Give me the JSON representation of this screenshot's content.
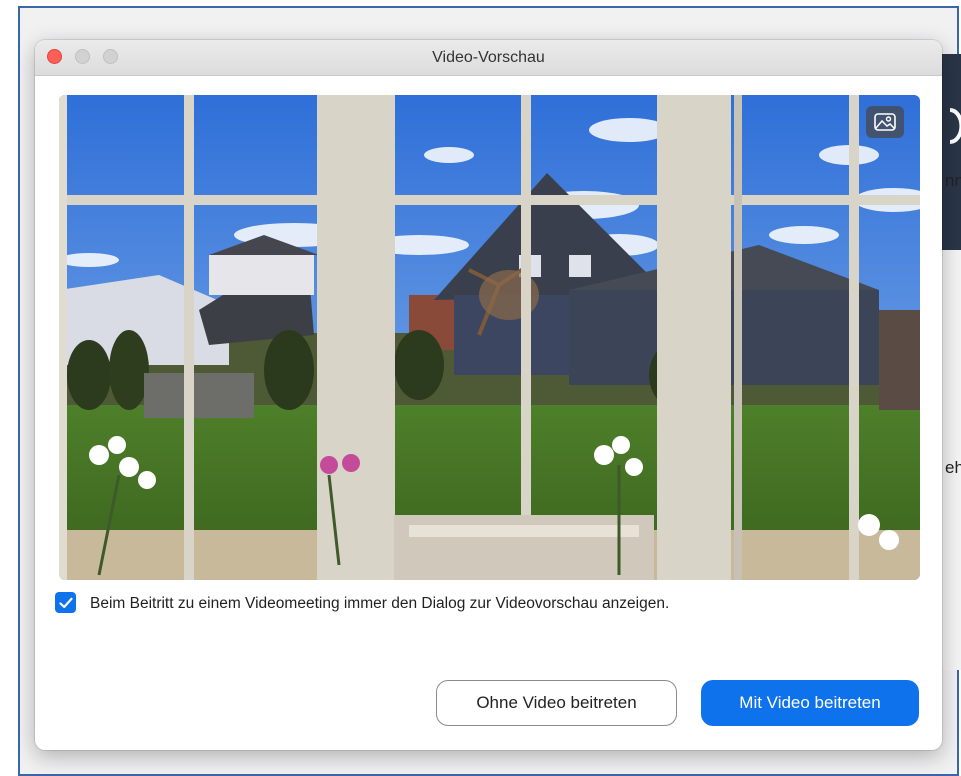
{
  "dialog": {
    "title": "Video-Vorschau",
    "checkbox": {
      "checked": true,
      "label": "Beim Beitritt zu einem Videomeeting immer den Dialog zur Videovorschau anzeigen."
    },
    "buttons": {
      "join_without_video": "Ohne Video beitreten",
      "join_with_video": "Mit Video beitreten"
    }
  },
  "background": {
    "glyph_top": "nn",
    "glyph_mid": "eh"
  },
  "icons": {
    "background_button": "image-icon",
    "checkbox": "checkmark-icon"
  },
  "colors": {
    "accent": "#0e72ed",
    "close": "#fe5f57"
  }
}
